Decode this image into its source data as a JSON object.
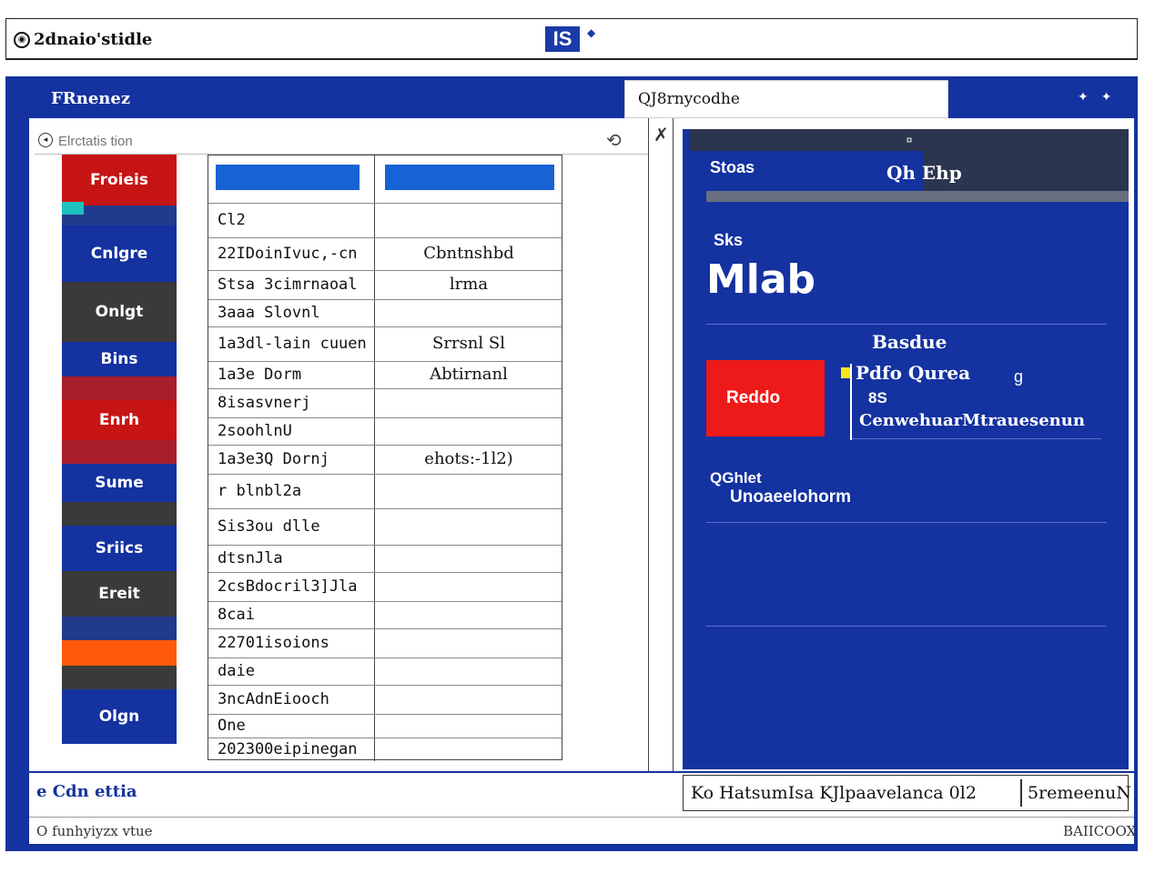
{
  "titlebar": {
    "title": "2dnaio'stidle",
    "logo": "IS"
  },
  "frame": {
    "title": "FRnenez",
    "search_value": "QJ8rnycodhe",
    "controls": [
      "✦",
      "✦"
    ]
  },
  "filter": {
    "placeholder": "Elrctatis tion"
  },
  "sidebar": {
    "items": [
      {
        "label": "Froieis",
        "color": "#c71414"
      },
      {
        "label": "",
        "color": "#203a8c"
      },
      {
        "label": "Cnlgre",
        "color": "#1432a0"
      },
      {
        "label": "Onlgt",
        "color": "#3a3a3a"
      },
      {
        "label": "Bins",
        "color": "#1432a0"
      },
      {
        "label": "",
        "color": "#a81e2a"
      },
      {
        "label": "Enrh",
        "color": "#c71414"
      },
      {
        "label": "",
        "color": "#a81e2a"
      },
      {
        "label": "Sume",
        "color": "#1432a0"
      },
      {
        "label": "",
        "color": "#3a3a3a"
      },
      {
        "label": "Sriics",
        "color": "#1432a0"
      },
      {
        "label": "Ereit",
        "color": "#3a3a3a"
      },
      {
        "label": "",
        "color": "#203a8c"
      },
      {
        "label": "",
        "color": "#ff5a0a"
      },
      {
        "label": "",
        "color": "#3a3a3a"
      },
      {
        "label": "Olgn",
        "color": "#1432a0"
      }
    ]
  },
  "table": {
    "rows": [
      {
        "c1": "Cl2",
        "c2": ""
      },
      {
        "c1": "22IDoinIvuc,-cn",
        "c2": "Cbntnshbd"
      },
      {
        "c1": "Stsa 3cimrnaoal",
        "c2": "lrma"
      },
      {
        "c1": "3aaa Slovnl",
        "c2": ""
      },
      {
        "c1": "1a3dl-lain cuuen",
        "c2": "Srrsnl Sl"
      },
      {
        "c1": "1a3e Dorm",
        "c2": "Abtirnanl"
      },
      {
        "c1": "8isasvnerj",
        "c2": ""
      },
      {
        "c1": "2soohlnU",
        "c2": ""
      },
      {
        "c1": "1a3e3Q Dornj",
        "c2": "ehots:-1l2)"
      },
      {
        "c1": "r blnbl2a",
        "c2": ""
      },
      {
        "c1": "Sis3ou dlle",
        "c2": ""
      },
      {
        "c1": "dtsnJla",
        "c2": ""
      },
      {
        "c1": "2csBdocril3]Jla",
        "c2": ""
      },
      {
        "c1": "8cai",
        "c2": ""
      },
      {
        "c1": "22701isoions",
        "c2": ""
      },
      {
        "c1": "daie",
        "c2": ""
      },
      {
        "c1": "3ncAdnEiooch",
        "c2": ""
      },
      {
        "c1": "One",
        "c2": ""
      },
      {
        "c1": "202300eipinegan",
        "c2": ""
      }
    ]
  },
  "right_panel": {
    "topbar": "¤",
    "tab1": "Stoas",
    "tab2": "Qh Ehp",
    "small_label": "Sks",
    "big_value": "Mlab",
    "sub_heading": "Basdue",
    "red_button": "Reddo",
    "detail_line1": "Pdfo Qurea",
    "detail_line1b": "g",
    "detail_line2": "8S",
    "detail_line3": "CenwehuarMtrauesenun",
    "footer_line1": "QGhlet",
    "footer_line2": "Unoaeelohorm"
  },
  "status": {
    "left": "e Cdn ettia",
    "right_main": "Ko HatsumIsa KJlpaavelanca  0l2",
    "right_tail": "5remeenuN"
  },
  "footer": {
    "left": "O funhyiyzx vtue",
    "right": "BAIICOOX"
  }
}
